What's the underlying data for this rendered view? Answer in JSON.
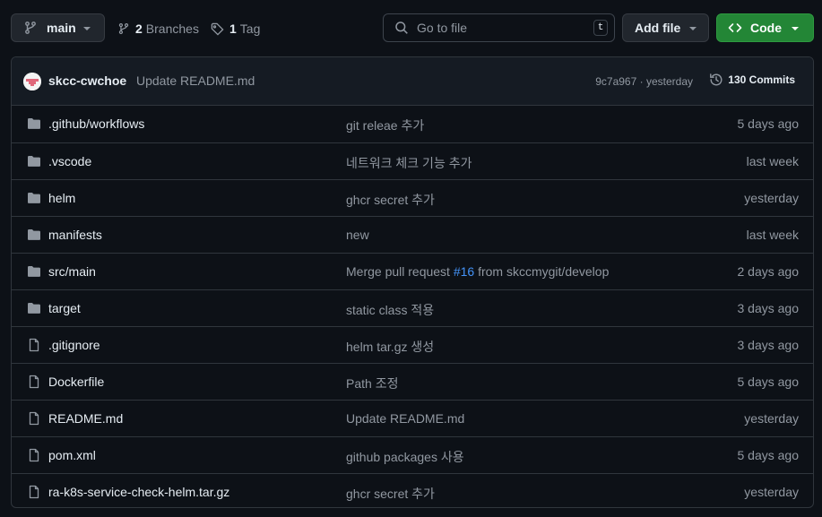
{
  "toolbar": {
    "branch_name": "main",
    "branches_count": "2",
    "branches_label": "Branches",
    "tags_count": "1",
    "tags_label": "Tag",
    "search_placeholder": "Go to file",
    "search_shortcut": "t",
    "add_file_label": "Add file",
    "code_label": "Code",
    "code_button_color": "#238636"
  },
  "latest_commit": {
    "author": "skcc-cwchoe",
    "message": "Update README.md",
    "sha": "9c7a967",
    "separator": "·",
    "time": "yesterday",
    "commits_count": "130",
    "commits_label": "Commits"
  },
  "files": [
    {
      "type": "folder",
      "icon": "folder-icon",
      "name": ".github/workflows",
      "message": "git releae 추가",
      "date": "5 days ago"
    },
    {
      "type": "folder",
      "icon": "folder-icon",
      "name": ".vscode",
      "message": "네트워크 체크 기능 추가",
      "date": "last week"
    },
    {
      "type": "folder",
      "icon": "folder-icon",
      "name": "helm",
      "message": "ghcr secret 추가",
      "date": "yesterday"
    },
    {
      "type": "folder",
      "icon": "folder-icon",
      "name": "manifests",
      "message": "new",
      "date": "last week"
    },
    {
      "type": "folder",
      "icon": "folder-icon",
      "name": "src/main",
      "message_pre": "Merge pull request ",
      "message_pr": "#16",
      "message_post": " from skccmygit/develop",
      "date": "2 days ago"
    },
    {
      "type": "folder",
      "icon": "folder-icon",
      "name": "target",
      "message": "static class 적용",
      "date": "3 days ago"
    },
    {
      "type": "file",
      "icon": "file-icon",
      "name": ".gitignore",
      "message": "helm tar.gz 생성",
      "date": "3 days ago"
    },
    {
      "type": "file",
      "icon": "file-icon",
      "name": "Dockerfile",
      "message": "Path 조정",
      "date": "5 days ago"
    },
    {
      "type": "file",
      "icon": "file-icon",
      "name": "README.md",
      "message": "Update README.md",
      "date": "yesterday"
    },
    {
      "type": "file",
      "icon": "file-icon",
      "name": "pom.xml",
      "message": "github packages 사용",
      "date": "5 days ago"
    },
    {
      "type": "file",
      "icon": "file-icon",
      "name": "ra-k8s-service-check-helm.tar.gz",
      "message": "ghcr secret 추가",
      "date": "yesterday"
    }
  ]
}
